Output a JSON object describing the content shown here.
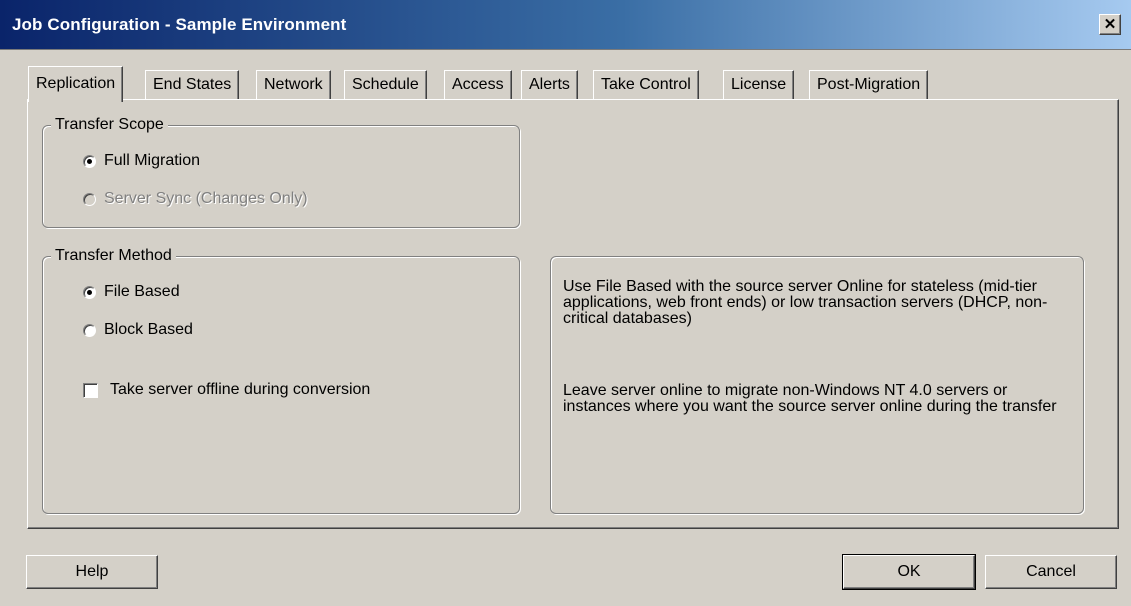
{
  "window": {
    "title": "Job Configuration - Sample Environment",
    "close_glyph": "✕"
  },
  "tabs": [
    {
      "label": "Replication",
      "active": true
    },
    {
      "label": "End States"
    },
    {
      "label": "Network"
    },
    {
      "label": "Schedule"
    },
    {
      "label": "Access"
    },
    {
      "label": "Alerts"
    },
    {
      "label": "Take Control"
    },
    {
      "label": "License"
    },
    {
      "label": "Post-Migration"
    }
  ],
  "transfer_scope": {
    "legend": "Transfer Scope",
    "options": [
      {
        "label": "Full Migration",
        "checked": true,
        "disabled": false
      },
      {
        "label": "Server Sync (Changes Only)",
        "checked": false,
        "disabled": true
      }
    ]
  },
  "transfer_method": {
    "legend": "Transfer Method",
    "options": [
      {
        "label": "File Based",
        "checked": true
      },
      {
        "label": "Block Based",
        "checked": false
      }
    ],
    "checkbox": {
      "label": "Take server offline during conversion",
      "checked": false
    }
  },
  "info": {
    "paragraph1": "Use File Based with the source server Online for stateless (mid-tier applications, web front ends) or low transaction servers (DHCP, non-critical databases)",
    "paragraph2": "Leave server online to migrate non-Windows NT 4.0 servers or instances where you want the source server online during the transfer"
  },
  "buttons": {
    "help": "Help",
    "ok": "OK",
    "cancel": "Cancel"
  }
}
